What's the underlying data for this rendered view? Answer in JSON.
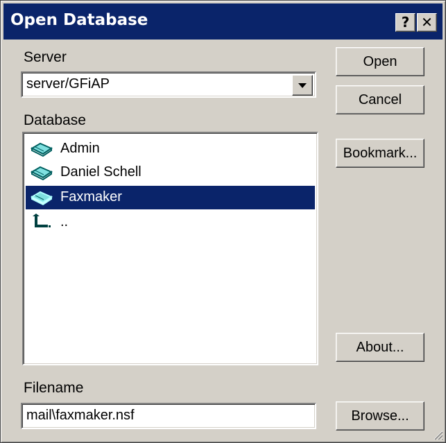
{
  "window": {
    "title": "Open Database"
  },
  "titlebar_buttons": {
    "help": "?",
    "close": "✕"
  },
  "server": {
    "label": "Server",
    "value": "server/GFiAP"
  },
  "database": {
    "label": "Database",
    "items": [
      {
        "label": "Admin",
        "icon": "database-book-icon",
        "selected": false
      },
      {
        "label": "Daniel Schell",
        "icon": "database-book-icon",
        "selected": false
      },
      {
        "label": "Faxmaker",
        "icon": "database-book-icon",
        "selected": true
      },
      {
        "label": "..",
        "icon": "parent-directory-icon",
        "selected": false
      }
    ]
  },
  "filename": {
    "label": "Filename",
    "value": "mail\\faxmaker.nsf"
  },
  "buttons": {
    "open": "Open",
    "cancel": "Cancel",
    "bookmark": "Bookmark...",
    "about": "About...",
    "browse": "Browse..."
  },
  "colors": {
    "titlebar": "#0a246a",
    "selection": "#0a246a",
    "face": "#d4d0c8"
  }
}
